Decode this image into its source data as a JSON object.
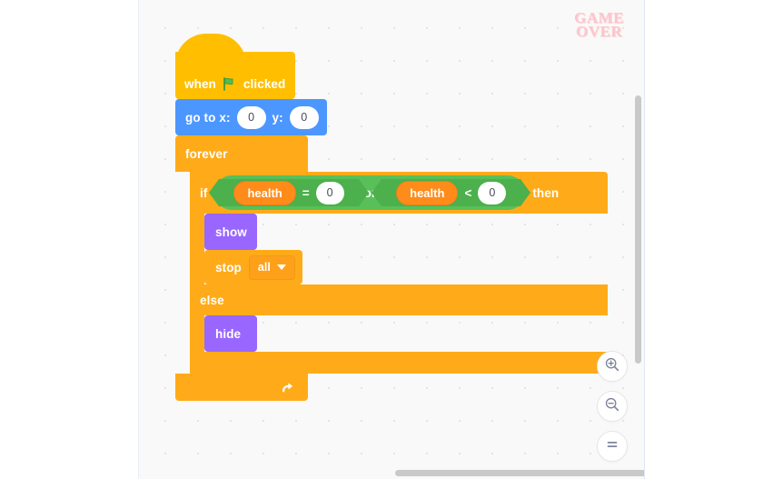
{
  "watermark": {
    "line1": "GAME",
    "line2": "OVER",
    "color": "#fcc6cb"
  },
  "palette": {
    "events": "#ffbf00",
    "motion": "#4c97ff",
    "control": "#ffab19",
    "operators": "#59c059",
    "variables": "#ff8c1a",
    "looks": "#9966ff",
    "canvas_bg": "#f9f9f9"
  },
  "script": {
    "hat": {
      "word_when": "when",
      "flag_icon": "green-flag-icon",
      "word_clicked": "clicked"
    },
    "goto": {
      "label_x": "go to x:",
      "value_x": "0",
      "label_y": "y:",
      "value_y": "0"
    },
    "forever": {
      "label": "forever",
      "loop_icon": "loop-arrow-icon"
    },
    "if_block": {
      "label_if": "if",
      "label_then": "then",
      "label_else": "else",
      "condition": {
        "operator": "or",
        "left": {
          "variable": "health",
          "comparator": "=",
          "value": "0"
        },
        "right": {
          "variable": "health",
          "comparator": "<",
          "value": "0"
        }
      },
      "then_branch": [
        {
          "type": "looks",
          "label": "show"
        },
        {
          "type": "control",
          "label": "stop",
          "dropdown_value": "all",
          "dropdown_icon": "chevron-down-icon"
        }
      ],
      "else_branch": [
        {
          "type": "looks",
          "label": "hide"
        }
      ]
    }
  },
  "zoom_controls": [
    {
      "name": "zoom-in",
      "icon": "magnifier-plus-icon"
    },
    {
      "name": "zoom-out",
      "icon": "magnifier-minus-icon"
    },
    {
      "name": "zoom-reset",
      "icon": "equals-icon"
    }
  ],
  "scrollbars": {
    "vertical": "vertical-scrollbar",
    "horizontal": "horizontal-scrollbar"
  }
}
